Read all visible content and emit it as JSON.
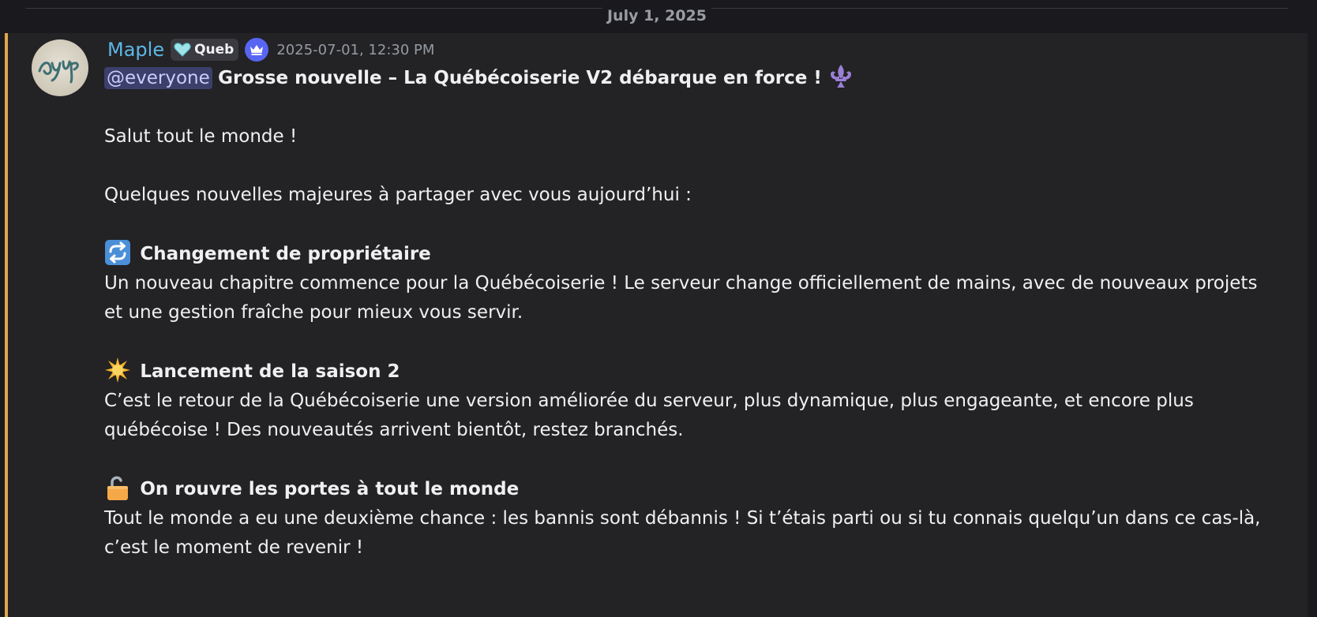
{
  "date_divider": "July 1, 2025",
  "message": {
    "author": "Maple",
    "role_tag": "Queb",
    "timestamp": "2025-07-01, 12:30 PM",
    "accent_color": "#e0a450",
    "mention": "@everyone",
    "title": "Grosse nouvelle – La Québécoiserie V2 débarque en force !",
    "greeting": "Salut tout le monde !",
    "intro": "Quelques nouvelles majeures à partager avec vous aujourd’hui :",
    "sections": [
      {
        "icon": "repeat-arrows-icon",
        "heading": "Changement de propriétaire",
        "body": "Un nouveau chapitre commence pour la Québécoiserie ! Le serveur change officiellement de mains, avec de nouveaux projets et une gestion fraîche pour mieux vous servir."
      },
      {
        "icon": "glowing-star-icon",
        "heading": "Lancement de la saison 2",
        "body": "C’est le retour de la Québécoiserie une version améliorée du serveur, plus dynamique, plus engageante, et encore plus québécoise ! Des nouveautés arrivent bientôt, restez branchés."
      },
      {
        "icon": "unlocked-padlock-icon",
        "heading": "On rouvre les portes à tout le monde",
        "body": "Tout le monde a eu une deuxième chance : les bannis sont débannis ! Si t’étais parti ou si tu connais quelqu’un dans ce cas-là, c’est le moment de revenir !"
      }
    ]
  }
}
